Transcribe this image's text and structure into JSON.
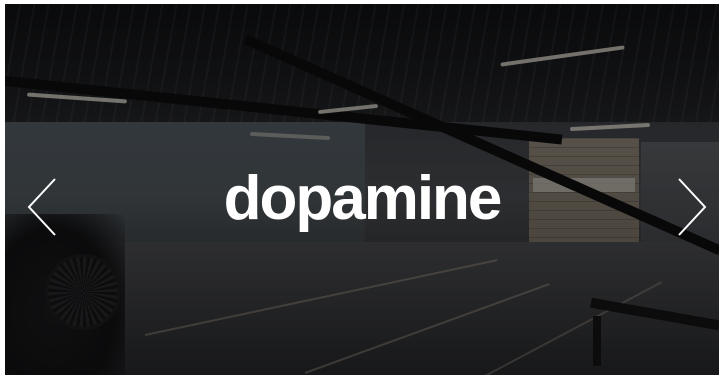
{
  "slider": {
    "logo_text": "dopamine",
    "prev_icon": "chevron-left-icon",
    "next_icon": "chevron-right-icon",
    "arrow_color": "#ffffff",
    "overlay_color": "#000000"
  }
}
